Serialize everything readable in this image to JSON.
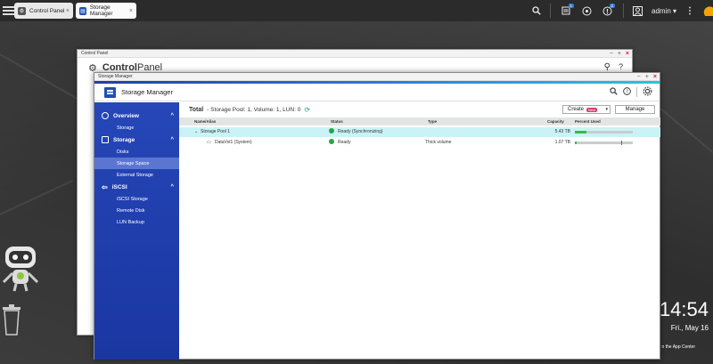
{
  "taskbar": {
    "tabs": [
      {
        "label": "Control Panel",
        "icon": "control-panel-icon",
        "close": "×"
      },
      {
        "label": "Storage Manager",
        "icon": "storage-manager-icon",
        "close": "×"
      }
    ],
    "notif_badges": [
      "1",
      "2"
    ],
    "user": "admin ▾"
  },
  "control_panel": {
    "window_title": "Control Panel",
    "title_bold": "Control",
    "title_rest": "Panel"
  },
  "storage_manager": {
    "window_title": "Storage Manager",
    "app_title": "Storage Manager",
    "sidebar": {
      "sections": [
        {
          "label": "Overview",
          "icon": "overview-icon",
          "items": [
            "Storage"
          ]
        },
        {
          "label": "Storage",
          "icon": "storage-icon",
          "items": [
            "Disks",
            "Storage Space",
            "External Storage"
          ]
        },
        {
          "label": "iSCSI",
          "icon": "iscsi-icon",
          "items": [
            "iSCSI Storage",
            "Remote Disk",
            "LUN Backup"
          ]
        }
      ],
      "active_item": "Storage Space"
    },
    "summary": {
      "label": "Total",
      "text": "- Storage Pool: 1, Volume: 1, LUN: 0"
    },
    "buttons": {
      "create": "Create",
      "create_tag": "New",
      "manage": "Manage"
    },
    "table": {
      "columns": [
        "Name/Alias",
        "Status",
        "Type",
        "Capacity",
        "Percent Used"
      ],
      "rows": [
        {
          "name": "Storage Pool 1",
          "status": "Ready (Synchronizing)",
          "type": "",
          "capacity": "5.43 TB",
          "percent_used": 0.2
        },
        {
          "name": "DataVol1 (System)",
          "status": "Ready",
          "type": "Thick volume",
          "capacity": "1.07 TB",
          "percent_used": 0.03
        }
      ]
    }
  },
  "desktop": {
    "clock": "14:54",
    "date": "Fri., May 16",
    "app_center_text": "n the App Center"
  }
}
